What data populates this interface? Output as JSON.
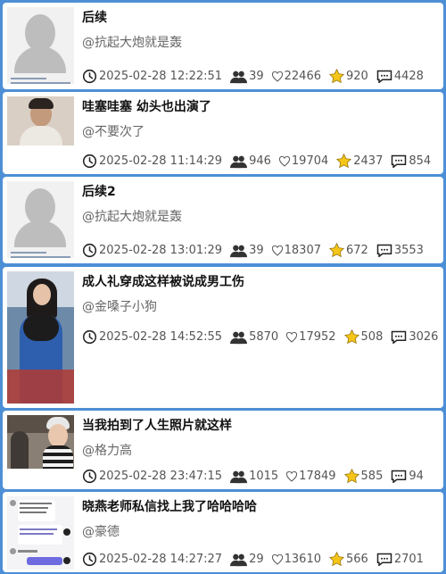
{
  "posts": [
    {
      "title": "后续",
      "author": "@抗起大炮就是轰",
      "date": "2025-02-28 12:22:51",
      "views": "39",
      "likes": "22466",
      "stars": "920",
      "comments": "4428"
    },
    {
      "title": "哇塞哇塞 幼头也出演了",
      "author": "@不要次了",
      "date": "2025-02-28 11:14:29",
      "views": "946",
      "likes": "19704",
      "stars": "2437",
      "comments": "854"
    },
    {
      "title": "后续2",
      "author": "@抗起大炮就是轰",
      "date": "2025-02-28 13:01:29",
      "views": "39",
      "likes": "18307",
      "stars": "672",
      "comments": "3553"
    },
    {
      "title": "成人礼穿成这样被说成男工伤",
      "author": "@金嗓子小狗",
      "date": "2025-02-28 14:52:55",
      "views": "5870",
      "likes": "17952",
      "stars": "508",
      "comments": "3026"
    },
    {
      "title": "当我拍到了人生照片就这样",
      "author": "@格力高",
      "date": "2025-02-28 23:47:15",
      "views": "1015",
      "likes": "17849",
      "stars": "585",
      "comments": "94"
    },
    {
      "title": "晓燕老师私信找上我了哈哈哈哈",
      "author": "@豪德",
      "date": "2025-02-28 14:27:27",
      "views": "29",
      "likes": "13610",
      "stars": "566",
      "comments": "2701"
    }
  ],
  "colors": {
    "background": "#4d8fd6",
    "star": "#f5c518"
  },
  "icons": {
    "date": "clock-icon",
    "views": "people-icon",
    "likes": "heart-icon",
    "stars": "star-icon",
    "comments": "comment-icon"
  }
}
